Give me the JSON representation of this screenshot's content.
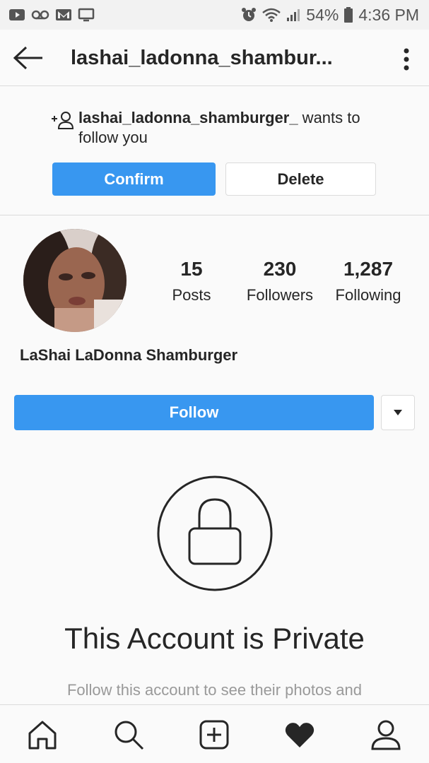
{
  "status_bar": {
    "battery": "54%",
    "time": "4:36 PM"
  },
  "header": {
    "title": "lashai_ladonna_shambur...",
    "back_icon": "arrow-left-icon",
    "more_icon": "more-vertical-icon"
  },
  "follow_request": {
    "username": "lashai_ladonna_shamburger_",
    "message_suffix": " wants to follow you",
    "confirm_label": "Confirm",
    "delete_label": "Delete"
  },
  "profile": {
    "full_name": "LaShai LaDonna Shamburger",
    "stats": {
      "posts_count": "15",
      "posts_label": "Posts",
      "followers_count": "230",
      "followers_label": "Followers",
      "following_count": "1,287",
      "following_label": "Following"
    },
    "follow_label": "Follow"
  },
  "private": {
    "title": "This Account is Private",
    "subtitle": "Follow this account to see their photos and"
  },
  "bottom_nav": {
    "items": [
      "home-icon",
      "search-icon",
      "add-post-icon",
      "activity-heart-icon",
      "profile-icon"
    ]
  },
  "colors": {
    "accent": "#3897f0",
    "text": "#262626",
    "muted": "#999999",
    "border": "#dbdbdb",
    "background": "#fafafa"
  }
}
